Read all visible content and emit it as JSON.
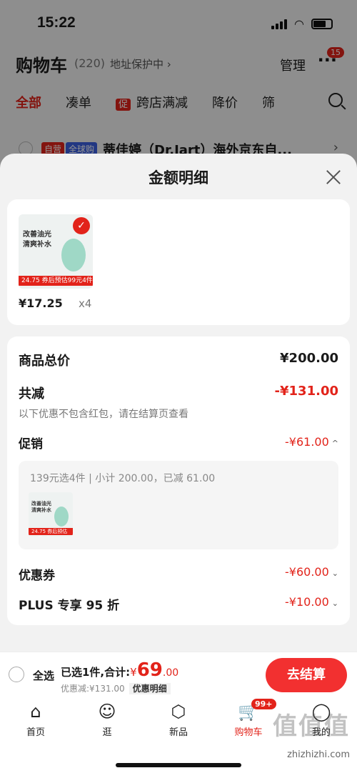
{
  "status_bar": {
    "time": "15:22"
  },
  "background": {
    "title": "购物车",
    "count": "(220)",
    "address_protect": "地址保护中 ›",
    "manage": "管理",
    "more_badge": "15",
    "tabs": [
      "全部",
      "凑单",
      "跨店满减",
      "降价",
      "筛"
    ],
    "promo_tag": "促",
    "shop": {
      "tag_self": "自营",
      "tag_global": "全球购",
      "name": "蒂佳婷（Dr.Jart）海外京东自...",
      "arrow": "›"
    }
  },
  "sheet": {
    "title": "金额明细",
    "product": {
      "image_text": "改善油光\n清爽补水",
      "image_price": "24.75 券后预估99元4件",
      "price": "¥17.25",
      "quantity": "x4"
    },
    "total_label": "商品总价",
    "total_value": "¥200.00",
    "discount_label": "共减",
    "discount_value": "-¥131.00",
    "discount_note": "以下优惠不包含红包，请在结算页查看",
    "promo_label": "促销",
    "promo_value": "-¥61.00",
    "promo_detail": "139元选4件 | 小计 200.00，已减 61.00",
    "coupon_label": "优惠券",
    "coupon_value": "-¥60.00",
    "plus_label": "PLUS 专享 95 折",
    "plus_value": "-¥10.00"
  },
  "checkout": {
    "select_all": "全选",
    "selected": "已选1件,合计:",
    "currency": "¥",
    "total_int": "69",
    "total_dec": ".00",
    "saved": "优惠减:¥131.00",
    "detail_tag": "优惠明细",
    "button": "去结算"
  },
  "tabbar": {
    "items": [
      "首页",
      "逛",
      "新品",
      "购物车",
      "我的"
    ],
    "cart_badge": "99+"
  },
  "watermark": "zhizhizhi.com",
  "colors": {
    "accent": "#e2231a",
    "button": "#f23030"
  }
}
